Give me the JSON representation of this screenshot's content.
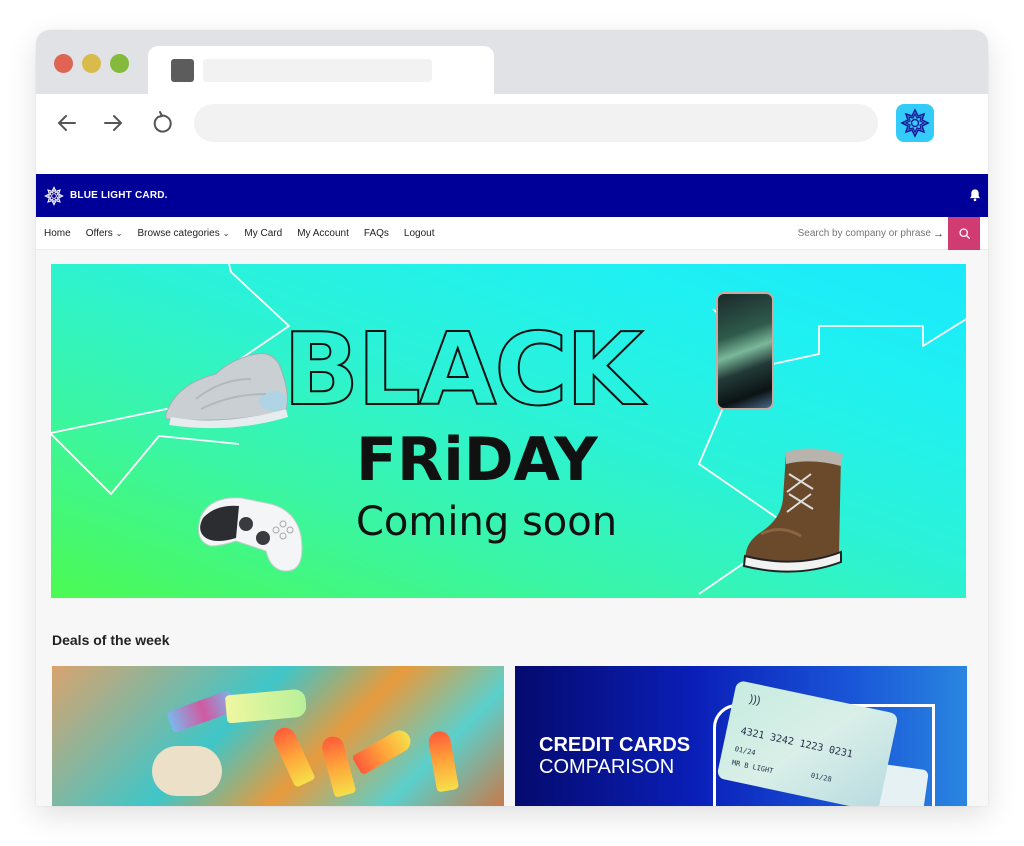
{
  "browser": {
    "window_controls": [
      "close",
      "minimize",
      "maximize"
    ],
    "tab": {
      "favicon": "favicon-placeholder",
      "title": ""
    },
    "address_bar": {
      "value": "",
      "placeholder": ""
    },
    "nav": {
      "back": "arrow-left-icon",
      "forward": "arrow-right-icon",
      "reload": "reload-icon"
    },
    "extension": {
      "name": "blue-light-card-extension",
      "color": "#33ccfa"
    }
  },
  "site": {
    "brand": {
      "name": "BLUE LIGHT CARD.",
      "color": "#000099"
    },
    "nav": {
      "items": [
        {
          "label": "Home",
          "dropdown": false
        },
        {
          "label": "Offers",
          "dropdown": true
        },
        {
          "label": "Browse categories",
          "dropdown": true
        },
        {
          "label": "My Card",
          "dropdown": false
        },
        {
          "label": "My Account",
          "dropdown": false
        },
        {
          "label": "FAQs",
          "dropdown": false
        },
        {
          "label": "Logout",
          "dropdown": false
        }
      ],
      "chevron": "⌄"
    },
    "search": {
      "placeholder": "Search by company or phrase",
      "arrow": "→",
      "button_color": "#d03b72"
    },
    "hero": {
      "line1": "BLACK",
      "line2": "FRiDAY",
      "line3": "Coming soon",
      "products": [
        "sneaker",
        "game-controller",
        "smartphone",
        "winter-boot"
      ]
    },
    "deals": {
      "title": "Deals of the week",
      "cards": [
        {
          "name": "ice-lollies-deal",
          "alt": "Ice lollies and ice cream"
        },
        {
          "name": "credit-cards-comparison-deal",
          "title": "CREDIT CARDS",
          "subtitle": "COMPARISON",
          "card_number": "4321 3242 1223 0231",
          "valid_from": "01/24",
          "expires": "01/28",
          "cardholder": "MR B LIGHT"
        }
      ]
    }
  }
}
